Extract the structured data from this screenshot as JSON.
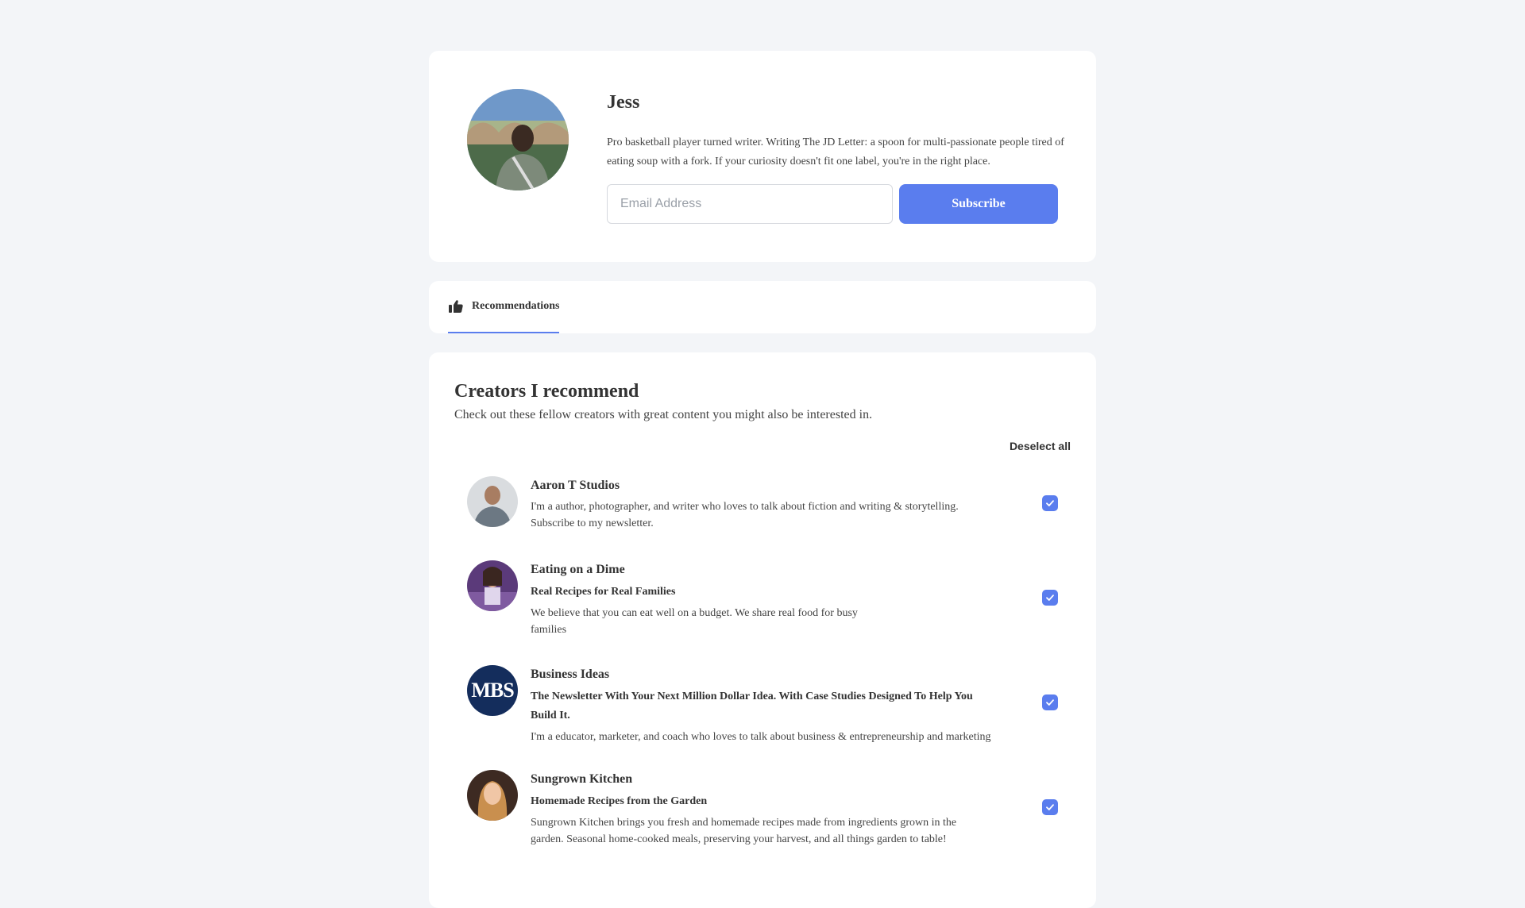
{
  "profile": {
    "name": "Jess",
    "bio": "Pro basketball player turned writer. Writing The JD Letter: a spoon for multi-passionate people tired of eating soup with a fork. If your curiosity doesn't fit one label, you're in the right place.",
    "email_placeholder": "Email Address",
    "subscribe_label": "Subscribe"
  },
  "tabs": [
    {
      "label": "Recommendations",
      "icon": "thumbs-up-icon",
      "active": true
    }
  ],
  "recommendations": {
    "title": "Creators I recommend",
    "subtitle": "Check out these fellow creators with great content you might also be interested in.",
    "deselect_label": "Deselect all",
    "items": [
      {
        "name": "Aaron T Studios",
        "tagline": "",
        "description": "I'm a author, photographer, and writer who loves to talk about fiction and writing & storytelling. Subscribe to my newsletter.",
        "checked": true
      },
      {
        "name": "Eating on a Dime",
        "tagline": "Real Recipes for Real Families",
        "description": "We believe that you can eat well on a budget. We share real food for busy families",
        "checked": true
      },
      {
        "name": "Business Ideas",
        "tagline": "The Newsletter With Your Next Million Dollar Idea. With Case Studies Designed To Help You Build It.",
        "description": "I'm a educator, marketer, and coach who loves to talk about business & entrepreneurship and marketing",
        "avatar_text": "MBS",
        "checked": true
      },
      {
        "name": "Sungrown Kitchen",
        "tagline": "Homemade Recipes from the Garden",
        "description": "Sungrown Kitchen brings you fresh and homemade recipes made from ingredients grown in the garden. Seasonal home-cooked meals, preserving your harvest, and all things garden to table!",
        "checked": true
      }
    ]
  },
  "colors": {
    "accent": "#5a7dee",
    "page_background": "#f3f5f8",
    "mbs_avatar": "#142d5c"
  }
}
